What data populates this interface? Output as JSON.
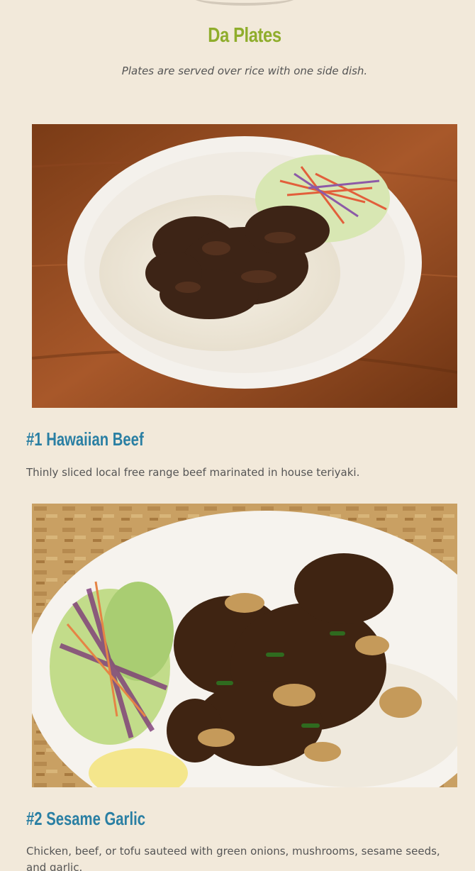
{
  "section": {
    "title": "Da Plates",
    "subtitle": "Plates are served over rice with one side dish."
  },
  "items": [
    {
      "title": "#1 Hawaiian Beef",
      "description": "Thinly sliced local free range beef marinated in house teriyaki.",
      "image_icon": "plate-photo-hawaiian-beef"
    },
    {
      "title": "#2 Sesame Garlic",
      "description": "Chicken, beef, or tofu sauteed with green onions, mushrooms, sesame seeds, and garlic.",
      "image_icon": "plate-photo-sesame-garlic"
    }
  ],
  "colors": {
    "background": "#f2e9da",
    "section_title": "#8fad2c",
    "item_title": "#2a7fa3",
    "body_text": "#555555"
  }
}
